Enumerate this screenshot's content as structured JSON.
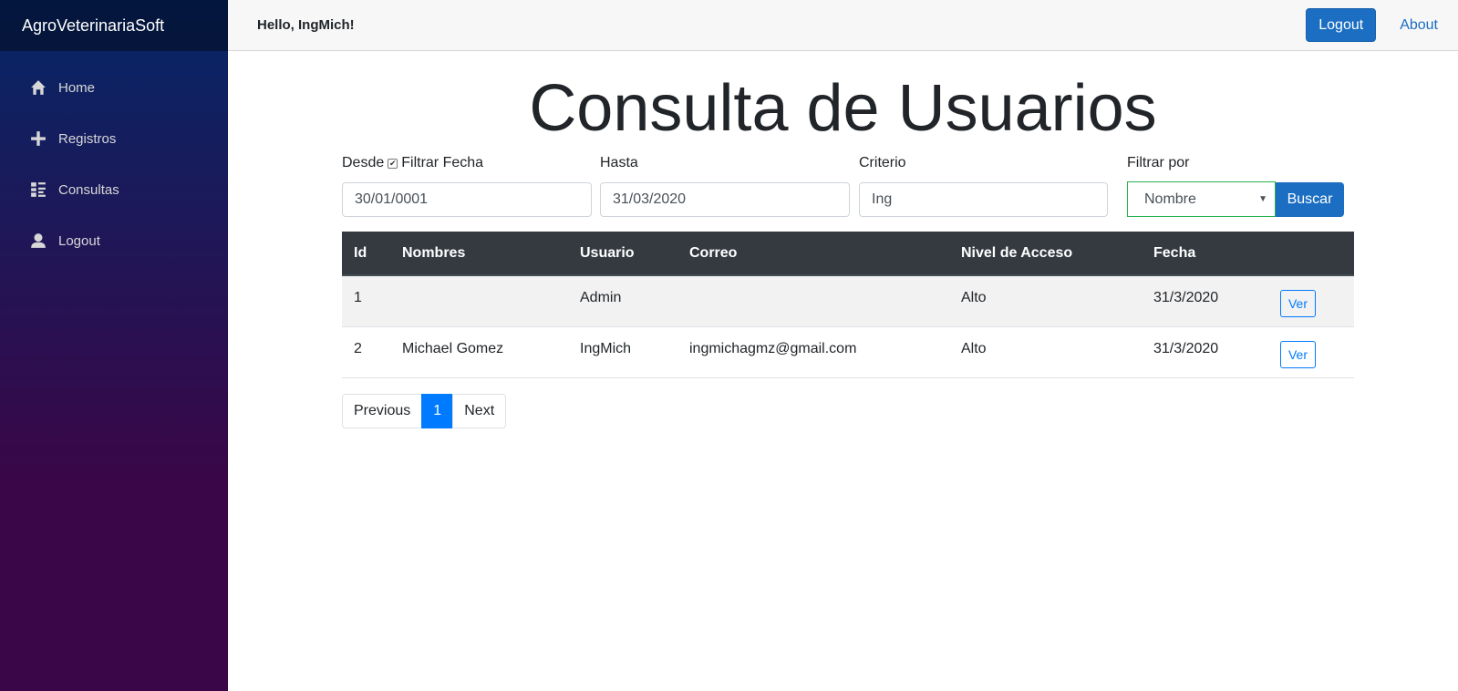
{
  "brand": "AgroVeterinariaSoft",
  "sidebar": {
    "items": [
      {
        "label": "Home",
        "icon": "home-icon"
      },
      {
        "label": "Registros",
        "icon": "plus-icon"
      },
      {
        "label": "Consultas",
        "icon": "list-icon"
      },
      {
        "label": "Logout",
        "icon": "person-icon"
      }
    ]
  },
  "topbar": {
    "greeting": "Hello, IngMich!",
    "logout_label": "Logout",
    "about_label": "About"
  },
  "page": {
    "title": "Consulta de Usuarios"
  },
  "filters": {
    "desde_label": "Desde",
    "filtrar_fecha_label": "Filtrar Fecha",
    "filtrar_fecha_checked": true,
    "desde_value": "30/01/0001",
    "hasta_label": "Hasta",
    "hasta_value": "31/03/2020",
    "criterio_label": "Criterio",
    "criterio_value": "Ing",
    "filtrar_por_label": "Filtrar por",
    "filtrar_por_value": "Nombre",
    "buscar_label": "Buscar"
  },
  "table": {
    "headers": [
      "Id",
      "Nombres",
      "Usuario",
      "Correo",
      "Nivel de Acceso",
      "Fecha"
    ],
    "rows": [
      {
        "id": "1",
        "nombres": "",
        "usuario": "Admin",
        "correo": "",
        "nivel": "Alto",
        "fecha": "31/3/2020",
        "action": "Ver"
      },
      {
        "id": "2",
        "nombres": "Michael Gomez",
        "usuario": "IngMich",
        "correo": "ingmichagmz@gmail.com",
        "nivel": "Alto",
        "fecha": "31/3/2020",
        "action": "Ver"
      }
    ]
  },
  "pagination": {
    "previous": "Previous",
    "current": "1",
    "next": "Next"
  },
  "colors": {
    "primary": "#1b6ec2",
    "link": "#007bff",
    "table_header": "#343a40",
    "sidebar_top": "#052767",
    "sidebar_bottom": "#3a0647"
  }
}
